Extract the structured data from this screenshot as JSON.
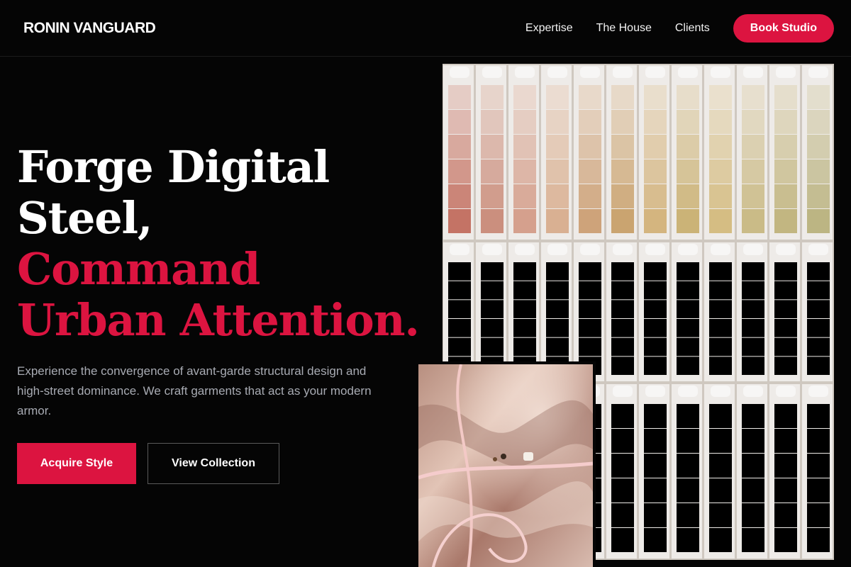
{
  "nav": {
    "brand": "RONIN VANGUARD",
    "links": [
      "Expertise",
      "The House",
      "Clients"
    ],
    "cta": "Book Studio"
  },
  "hero": {
    "title_line_1": "Forge Digital",
    "title_line_2": "Steel,",
    "title_line_3": "Command",
    "title_line_4": "Urban Attention.",
    "subtitle": "Experience the convergence of avant-garde structural design and high-street dominance. We craft garments that act as your modern armor.",
    "primary_button": "Acquire Style",
    "secondary_button": "View Collection"
  },
  "colors": {
    "accent": "#dc1440",
    "background": "#050505",
    "muted_text": "#a8abb3"
  }
}
